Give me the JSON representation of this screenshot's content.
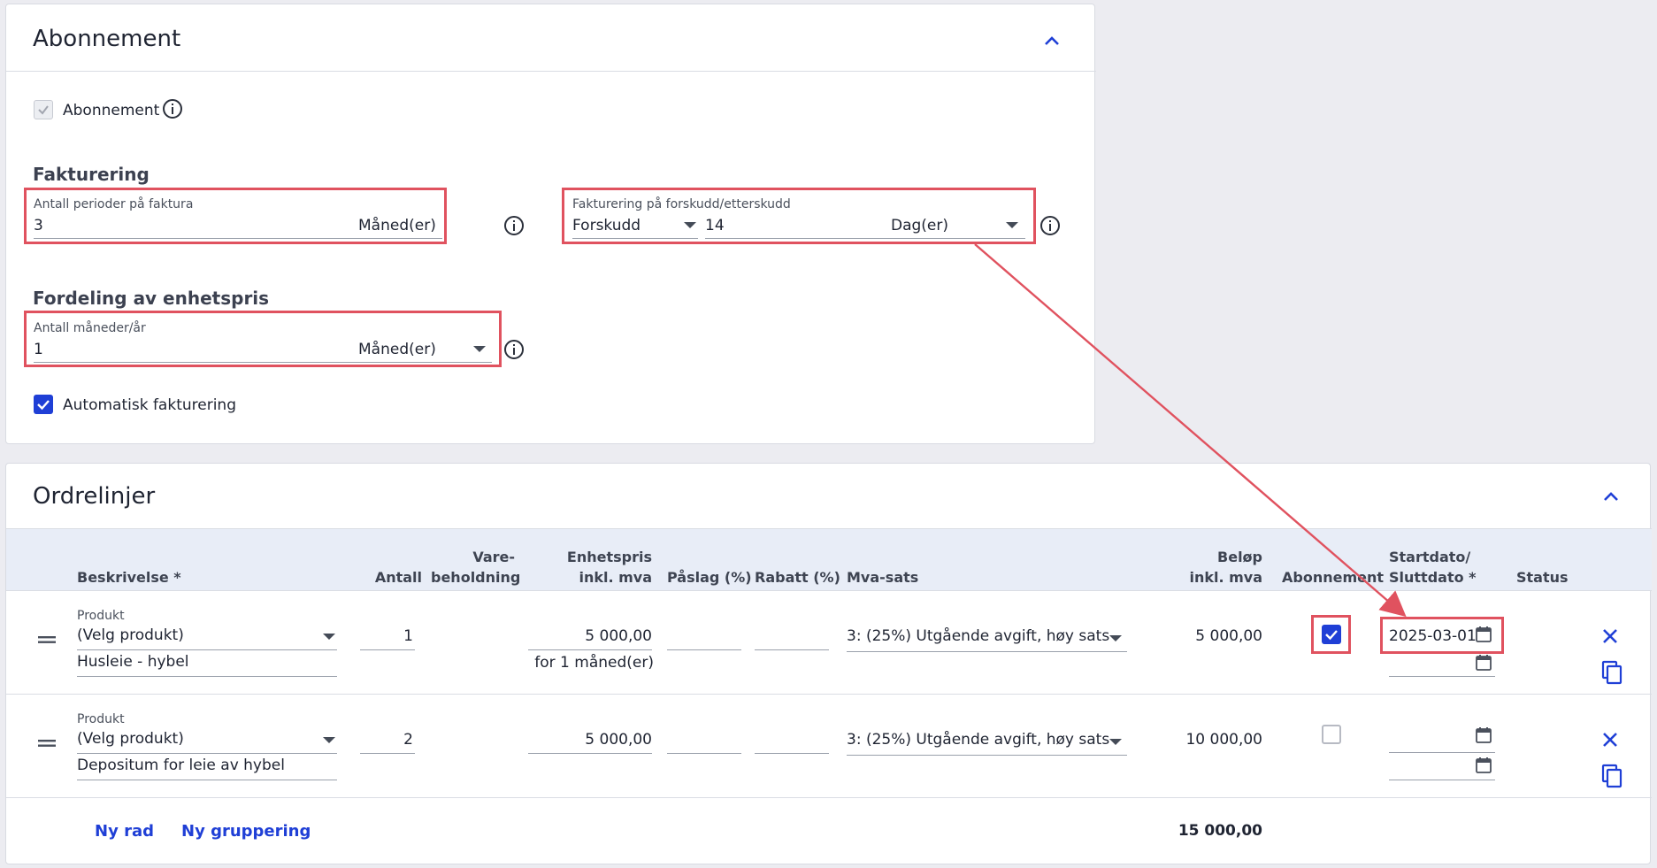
{
  "subscription_card": {
    "title": "Abonnement",
    "checkbox_label": "Abonnement",
    "invoicing_heading": "Fakturering",
    "periods_field": {
      "label": "Antall perioder på faktura",
      "value": "3",
      "unit": "Måned(er)"
    },
    "advance_field": {
      "label": "Fakturering på forskudd/etterskudd",
      "mode": "Forskudd",
      "days": "14",
      "unit": "Dag(er)"
    },
    "distribution_heading": "Fordeling av enhetspris",
    "months_field": {
      "label": "Antall måneder/år",
      "value": "1",
      "unit": "Måned(er)"
    },
    "auto_invoice_label": "Automatisk fakturering"
  },
  "order_lines_card": {
    "title": "Ordrelinjer",
    "headers": {
      "description": "Beskrivelse *",
      "quantity": "Antall",
      "stock_1": "Vare-",
      "stock_2": "beholdning",
      "unit_price_1": "Enhetspris",
      "unit_price_2": "inkl. mva",
      "markup": "Påslag (%)",
      "discount": "Rabatt (%)",
      "vat": "Mva-sats",
      "amount_1": "Beløp",
      "amount_2": "inkl. mva",
      "subscription": "Abonnement",
      "dates_1": "Startdato/",
      "dates_2": "Sluttdato *",
      "status": "Status"
    },
    "rows": [
      {
        "product_label": "Produkt",
        "product": "(Velg produkt)",
        "description": "Husleie - hybel",
        "quantity": "1",
        "unit_price": "5 000,00",
        "price_note": "for 1 måned(er)",
        "vat": "3: (25%) Utgående avgift, høy sats",
        "amount": "5 000,00",
        "subscription": true,
        "start_date": "2025-03-01"
      },
      {
        "product_label": "Produkt",
        "product": "(Velg produkt)",
        "description": "Depositum for leie av hybel",
        "quantity": "2",
        "unit_price": "5 000,00",
        "vat": "3: (25%) Utgående avgift, høy sats",
        "amount": "10 000,00",
        "subscription": false,
        "start_date": ""
      }
    ],
    "new_row": "Ny rad",
    "new_group": "Ny gruppering",
    "total": "15 000,00"
  },
  "colors": {
    "accent": "#1f3fd6",
    "highlight": "#e0525f",
    "header_bg": "#e8edf7"
  },
  "icons": [
    "chevron-up-icon",
    "info-icon",
    "check-icon",
    "caret-down-icon",
    "drag-handle-icon",
    "calendar-icon",
    "close-icon",
    "copy-icon"
  ]
}
